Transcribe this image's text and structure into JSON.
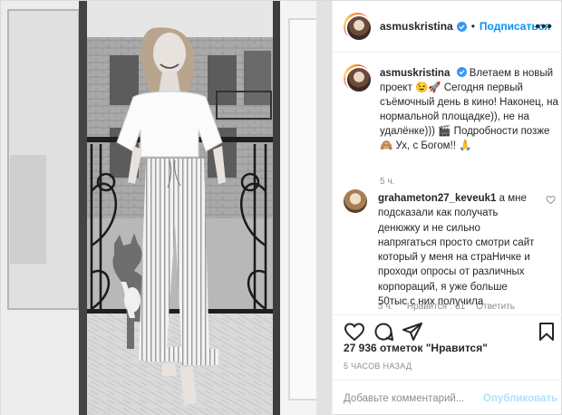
{
  "header": {
    "username": "asmuskristina",
    "separator": "•",
    "follow_label": "Подписаться",
    "more_label": "•••"
  },
  "caption": {
    "username": "asmuskristina",
    "text": "Влетаем в новый проект 😉🚀 Сегодня первый съёмочный день в кино! Наконец, на нормальной площадке)), не на удалёнке))) 🎬 Подробности позже 🙈 Ух, с Богом!! 🙏",
    "time": "5 ч."
  },
  "comment": {
    "username": "grahameton27_keveuk1",
    "text": "а мне подсказали как получать денюжку и не сильно напрягаться просто смотри сайт который у меня на страНичке и проходи опросы от различных корпораций, я уже больше 50тыс с них получила",
    "time": "5 ч.",
    "likes": "\"Нравится\": 31",
    "reply_label": "Ответить"
  },
  "likes_text": "27 936 отметок \"Нравится\"",
  "posted_ago": "5 ЧАСОВ НАЗАД",
  "composer": {
    "placeholder": "Добавьте комментарий...",
    "publish_label": "Опубликовать"
  },
  "colors": {
    "accent": "#0095f6",
    "publish_disabled": "#b2dffc",
    "muted": "#8e8e8e",
    "border": "#dbdbdb"
  }
}
